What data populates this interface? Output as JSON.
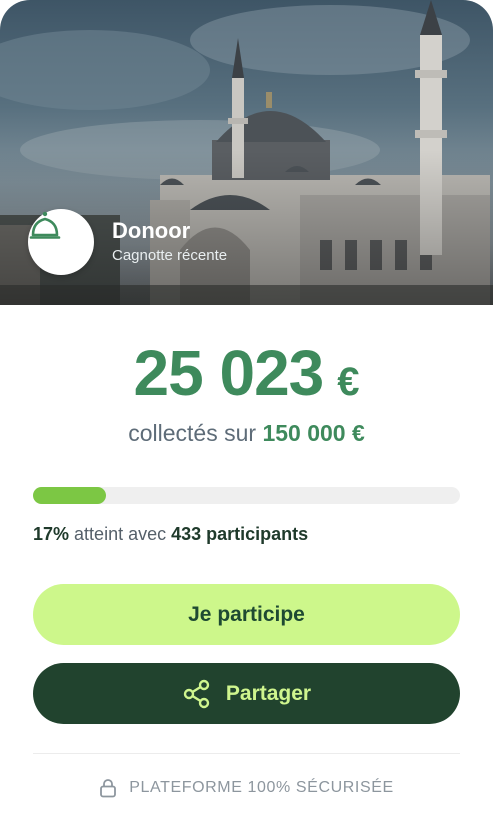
{
  "hero": {
    "image": "mosque-photo",
    "organization": {
      "name": "Donoor",
      "subtitle": "Cagnotte récente",
      "logo": "mosque-dome-icon"
    }
  },
  "campaign": {
    "amount": "25 023",
    "currency": "€",
    "goal_prefix": "collectés sur",
    "goal_amount": "150 000 €",
    "progress_percent": 17,
    "progress_label": "17%",
    "progress_text": "atteint avec",
    "participants_label": "433 participants"
  },
  "actions": {
    "participate_label": "Je participe",
    "share_label": "Partager",
    "share_icon": "share-icon"
  },
  "footer": {
    "secure_label": "PLATEFORME 100% SÉCURISÉE",
    "icon": "lock-icon"
  },
  "colors": {
    "accent_green": "#3e8a5c",
    "progress_fill": "#7cc744",
    "participate_bg": "#cdf78b",
    "share_bg": "#21432e",
    "share_text": "#cff58e"
  }
}
